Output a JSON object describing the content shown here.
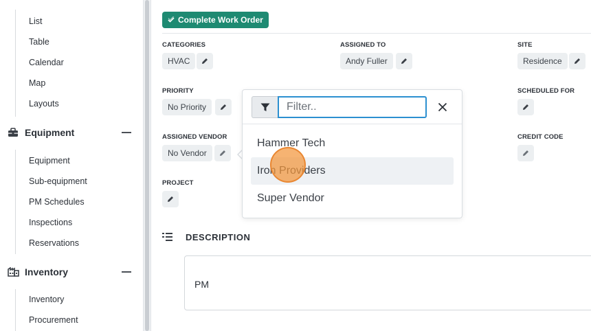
{
  "sidebar": {
    "group_top_items": [
      "List",
      "Table",
      "Calendar",
      "Map",
      "Layouts"
    ],
    "sections": [
      {
        "label": "Equipment",
        "icon": "toolbox-icon",
        "items": [
          "Equipment",
          "Sub-equipment",
          "PM Schedules",
          "Inspections",
          "Reservations"
        ]
      },
      {
        "label": "Inventory",
        "icon": "warehouse-icon",
        "items": [
          "Inventory",
          "Procurement"
        ]
      }
    ]
  },
  "main": {
    "complete_button": "Complete Work Order",
    "fields": {
      "categories": {
        "label": "CATEGORIES",
        "value": "HVAC"
      },
      "assigned_to": {
        "label": "ASSIGNED TO",
        "value": "Andy Fuller"
      },
      "site": {
        "label": "SITE",
        "value": "Residence"
      },
      "priority": {
        "label": "PRIORITY",
        "value": "No Priority"
      },
      "scheduled_for": {
        "label": "SCHEDULED FOR"
      },
      "assigned_vendor": {
        "label": "ASSIGNED VENDOR",
        "value": "No Vendor"
      },
      "credit_code": {
        "label": "CREDIT CODE"
      },
      "project": {
        "label": "PROJECT"
      }
    },
    "description": {
      "title": "DESCRIPTION",
      "text": "PM"
    }
  },
  "vendor_dropdown": {
    "filter_placeholder": "Filter..",
    "filter_value": "",
    "options": [
      "Hammer Tech",
      "Iron Providers",
      "Super Vendor"
    ],
    "hovered_option": "Iron Providers"
  },
  "colors": {
    "accent_green": "#1e8a72",
    "focus_blue": "#2b8fd0",
    "chip_bg": "#eceff1",
    "cursor_orange": "#f3963c"
  }
}
